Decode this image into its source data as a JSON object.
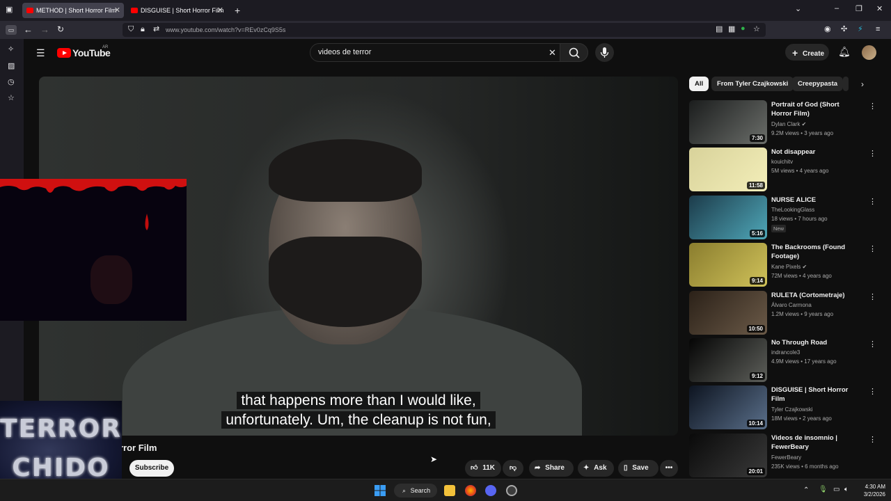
{
  "browser": {
    "tabs": [
      {
        "label": "METHOD | Short Horror Film",
        "active": true
      },
      {
        "label": "DISGUISE | Short Horror Film",
        "active": false
      }
    ],
    "url": "www.youtube.com/watch?v=REv0zCq9S5s"
  },
  "youtube": {
    "logo_text": "YouTube",
    "country_code": "AR",
    "search_value": "videos de terror",
    "create_label": "Create"
  },
  "player": {
    "caption_line1": "that happens more than I would like,",
    "caption_line2": "unfortunately. Um, the cleanup is not fun,"
  },
  "overlay": {
    "line1": "TERROR",
    "line2": "CHIDO"
  },
  "video": {
    "title_fragment": "rror Film",
    "subscribe_label": "Subscribe",
    "like_count": "11K",
    "share_label": "Share",
    "ask_label": "Ask",
    "save_label": "Save"
  },
  "chips": [
    "All",
    "From Tyler Czajkowski",
    "Creepypasta"
  ],
  "recommendations": [
    {
      "title": "Portrait of God (Short Horror Film)",
      "channel": "Dylan Clark",
      "verified": true,
      "meta": "9.2M views • 3 years ago",
      "duration": "7:30",
      "thumb_colors": [
        "#1b1d1d",
        "#6b6e6a"
      ]
    },
    {
      "title": "Not disappear",
      "channel": "kouichitv",
      "verified": false,
      "meta": "5M views • 4 years ago",
      "duration": "11:58",
      "thumb_colors": [
        "#d8d29a",
        "#f3eeb9"
      ]
    },
    {
      "title": "NURSE ALICE",
      "channel": "TheLookingGlass",
      "verified": false,
      "meta": "18 views • 7 hours ago",
      "badge": "New",
      "duration": "5:16",
      "thumb_colors": [
        "#1c3b4a",
        "#4fa7b8"
      ]
    },
    {
      "title": "The Backrooms (Found Footage)",
      "channel": "Kane Pixels",
      "verified": true,
      "meta": "72M views • 4 years ago",
      "duration": "9:14",
      "thumb_colors": [
        "#8a7d2e",
        "#d0c25a"
      ]
    },
    {
      "title": "RULETA (Cortometraje)",
      "channel": "Álvaro Carmona",
      "verified": false,
      "meta": "1.2M views • 9 years ago",
      "duration": "10:50",
      "thumb_colors": [
        "#2b2118",
        "#6b5a48"
      ]
    },
    {
      "title": "No Through Road",
      "channel": "indrancole3",
      "verified": false,
      "meta": "4.9M views • 17 years ago",
      "duration": "9:12",
      "thumb_colors": [
        "#050505",
        "#5d5f5a"
      ]
    },
    {
      "title": "DISGUISE | Short Horror Film",
      "channel": "Tyler Czajkowski",
      "verified": false,
      "meta": "18M views • 2 years ago",
      "duration": "10:14",
      "thumb_colors": [
        "#0d1420",
        "#5a6f8a"
      ]
    },
    {
      "title": "Videos de insomnio | FewerBeary",
      "channel": "FewerBeary",
      "verified": false,
      "meta": "235K views • 6 months ago",
      "duration": "20:01",
      "thumb_colors": [
        "#0a0a0a",
        "#3a3a3a"
      ]
    }
  ],
  "taskbar": {
    "search_label": "Search",
    "time": "4:30 AM",
    "date": "3/2/2026"
  }
}
